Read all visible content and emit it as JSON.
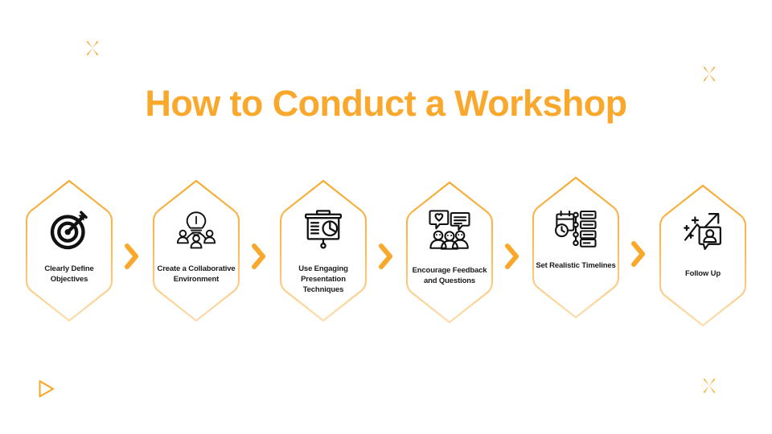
{
  "slide": {
    "title": "How to Conduct a Workshop",
    "background_color": "#FFFFFF",
    "accent_color": "#F9A82B",
    "accent_light_color": "#FBD69B",
    "text_color": "#1B1B1B"
  },
  "steps": [
    {
      "label": "Clearly Define Objectives",
      "icon": "target-arrow-icon"
    },
    {
      "label": "Create a Collaborative Environment",
      "icon": "lightbulb-team-icon"
    },
    {
      "label": "Use Engaging Presentation Techniques",
      "icon": "presentation-chart-icon"
    },
    {
      "label": "Encourage Feedback and Questions",
      "icon": "people-speech-bubble-icon"
    },
    {
      "label": "Set Realistic Timelines",
      "icon": "calendar-timeline-icon"
    },
    {
      "label": "Follow Up",
      "icon": "growth-arrow-person-icon"
    }
  ],
  "decorations": [
    {
      "name": "sparkle-top-left",
      "type": "four-point-sparkle"
    },
    {
      "name": "sparkle-top-right",
      "type": "four-point-sparkle"
    },
    {
      "name": "sparkle-bottom-right",
      "type": "four-point-sparkle"
    },
    {
      "name": "play-triangle-bottom-left",
      "type": "play-triangle-outline"
    }
  ],
  "connectors": {
    "count": 5,
    "glyph": "chevron-right"
  }
}
